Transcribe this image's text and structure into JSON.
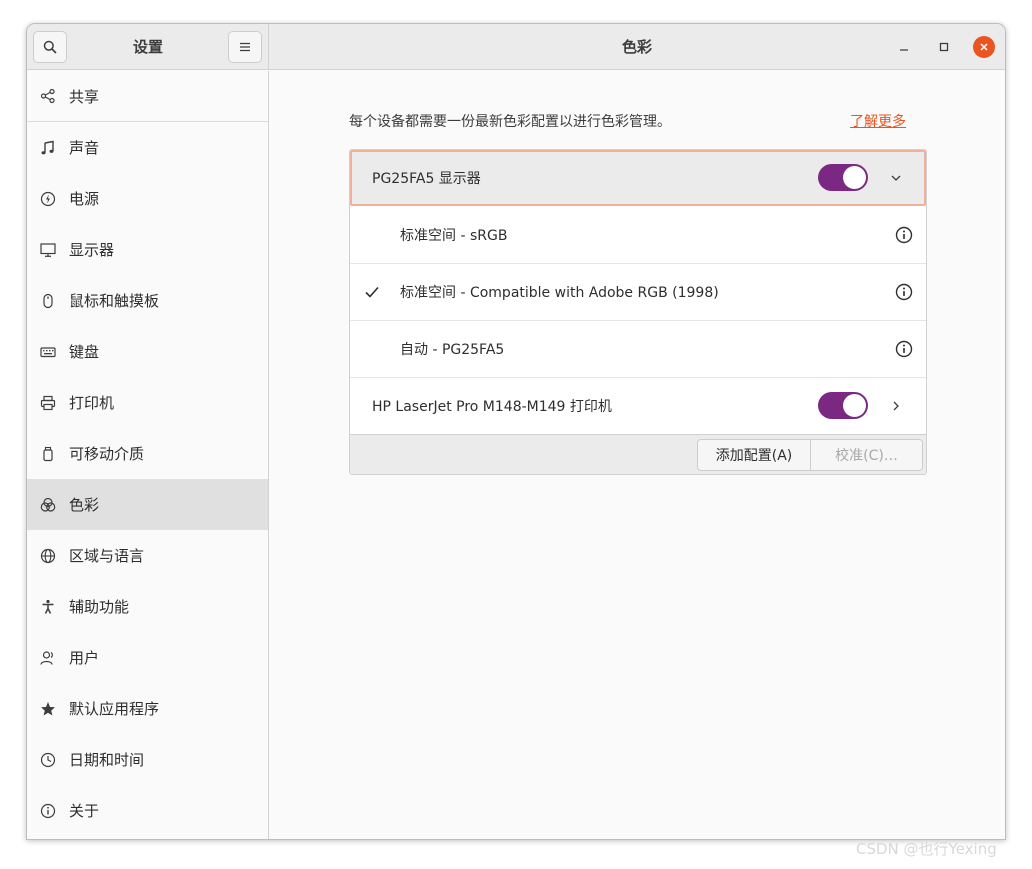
{
  "window": {
    "sidebar_title": "设置",
    "main_title": "色彩"
  },
  "sidebar": {
    "items": [
      {
        "label": "共享",
        "icon": "share-icon"
      },
      {
        "label": "声音",
        "icon": "music-note-icon"
      },
      {
        "label": "电源",
        "icon": "power-icon"
      },
      {
        "label": "显示器",
        "icon": "display-icon"
      },
      {
        "label": "鼠标和触摸板",
        "icon": "mouse-icon"
      },
      {
        "label": "键盘",
        "icon": "keyboard-icon"
      },
      {
        "label": "打印机",
        "icon": "printer-icon"
      },
      {
        "label": "可移动介质",
        "icon": "removable-media-icon"
      },
      {
        "label": "色彩",
        "icon": "color-icon",
        "active": true
      },
      {
        "label": "区域与语言",
        "icon": "globe-icon"
      },
      {
        "label": "辅助功能",
        "icon": "accessibility-icon"
      },
      {
        "label": "用户",
        "icon": "users-icon"
      },
      {
        "label": "默认应用程序",
        "icon": "star-icon"
      },
      {
        "label": "日期和时间",
        "icon": "clock-icon"
      },
      {
        "label": "关于",
        "icon": "info-icon"
      }
    ]
  },
  "main": {
    "intro": "每个设备都需要一份最新色彩配置以进行色彩管理。",
    "learn_more": "了解更多",
    "devices": [
      {
        "name": "PG25FA5 显示器",
        "enabled": true,
        "expanded": true,
        "profiles": [
          {
            "label": "标准空间 - sRGB",
            "checked": false
          },
          {
            "label": "标准空间 - Compatible with Adobe RGB (1998)",
            "checked": true
          },
          {
            "label": "自动 - PG25FA5",
            "checked": false
          }
        ]
      },
      {
        "name": "HP LaserJet Pro M148-M149 打印机",
        "enabled": true,
        "expanded": false
      }
    ],
    "add_profile_label": "添加配置(A)",
    "calibrate_label": "校准(C)…"
  },
  "colors": {
    "accent": "#e95420",
    "toggle_on": "#7b2882"
  },
  "watermark": "CSDN @也行Yexing"
}
